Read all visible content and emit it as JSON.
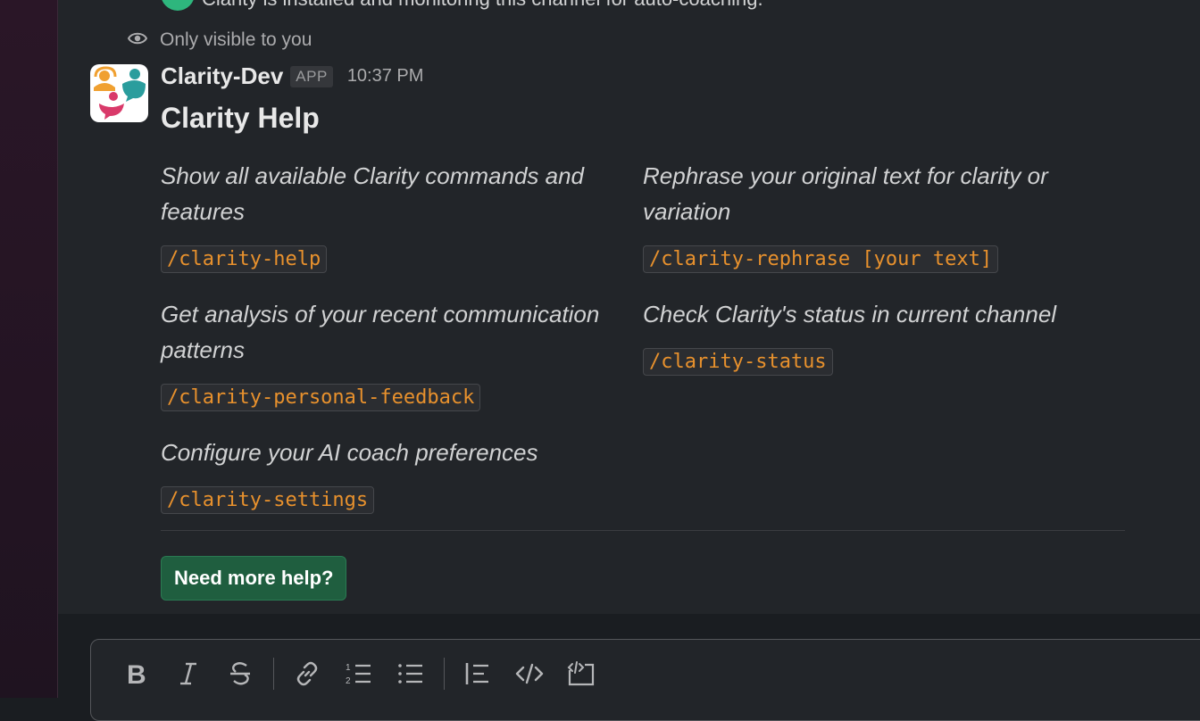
{
  "top_message": {
    "text": "Clarity is installed and monitoring this channel for auto-coaching."
  },
  "visibility": {
    "label": "Only visible to you"
  },
  "message": {
    "sender": "Clarity-Dev",
    "badge": "APP",
    "time": "10:37 PM",
    "title": "Clarity Help",
    "commands": [
      {
        "description": "Show all available Clarity commands and features",
        "command": "/clarity-help"
      },
      {
        "description": "Rephrase your original text for clarity or variation",
        "command": "/clarity-rephrase [your text]"
      },
      {
        "description": "Get analysis of your recent communication patterns",
        "command": "/clarity-personal-feedback"
      },
      {
        "description": "Check Clarity's status in current channel",
        "command": "/clarity-status"
      },
      {
        "description": "Configure your AI coach preferences",
        "command": "/clarity-settings"
      }
    ],
    "button_label": "Need more help?"
  },
  "composer": {
    "toolbar": [
      "bold-icon",
      "italic-icon",
      "strikethrough-icon",
      "link-icon",
      "numbered-list-icon",
      "bulleted-list-icon",
      "blockquote-icon",
      "code-icon",
      "code-block-icon"
    ]
  },
  "colors": {
    "code_text": "#e8912d",
    "button_bg": "#1f5e3f",
    "status_dot": "#2eb67d"
  }
}
